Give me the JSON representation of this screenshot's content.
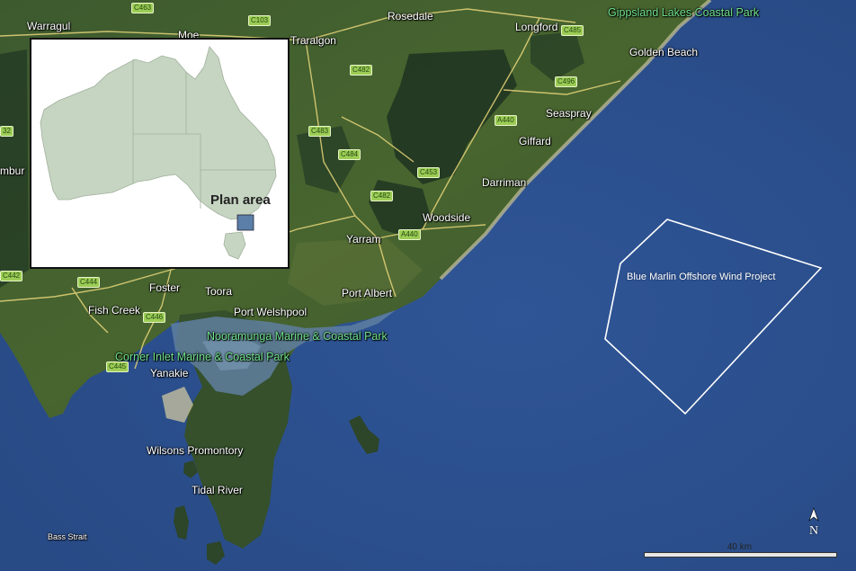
{
  "map": {
    "places": {
      "warragul": "Warragul",
      "moe": "Moe",
      "traralgon": "Traralgon",
      "rosedale": "Rosedale",
      "longford": "Longford",
      "golden_beach": "Golden Beach",
      "seaspray": "Seaspray",
      "giffard": "Giffard",
      "darriman": "Darriman",
      "woodside": "Woodside",
      "yarram": "Yarram",
      "port_albert": "Port Albert",
      "port_welshpool": "Port Welshpool",
      "toora": "Toora",
      "foster": "Foster",
      "fish_creek": "Fish Creek",
      "yanakie": "Yanakie",
      "wilsons_promontory": "Wilsons Promontory",
      "tidal_river": "Tidal River",
      "bass_strait": "Bass Strait",
      "leongatha_fragment": "mbur"
    },
    "parks": {
      "gippsland_lakes": "Gippsland Lakes Coastal Park",
      "nooramunga": "Nooramunga Marine & Coastal Park",
      "corner_inlet": "Corner Inlet Marine & Coastal Park"
    },
    "roads": {
      "c463": "C463",
      "c103": "C103",
      "c485": "C485",
      "c482_top": "C482",
      "c496": "C496",
      "a440_north": "A440",
      "c483": "C483",
      "c484": "C484",
      "c453": "C453",
      "c482_mid": "C482",
      "a440_south": "A440",
      "c442": "C442",
      "c444": "C444",
      "c446": "C446",
      "c445": "C445",
      "c32": "32"
    },
    "project_label": "Blue Marlin Offshore Wind Project",
    "scale_label": "40 km",
    "north_label": "N",
    "north_icon": "north-arrow-icon",
    "colors": {
      "ocean": "#2b4f8c",
      "land": "#3f5a2e",
      "park_label": "#6fe08a",
      "project_outline": "#ffffff"
    }
  },
  "inset": {
    "title": "Plan area",
    "colors": {
      "australia_fill": "#c6d5c2",
      "plan_area_fill": "#5b7fa8"
    }
  }
}
